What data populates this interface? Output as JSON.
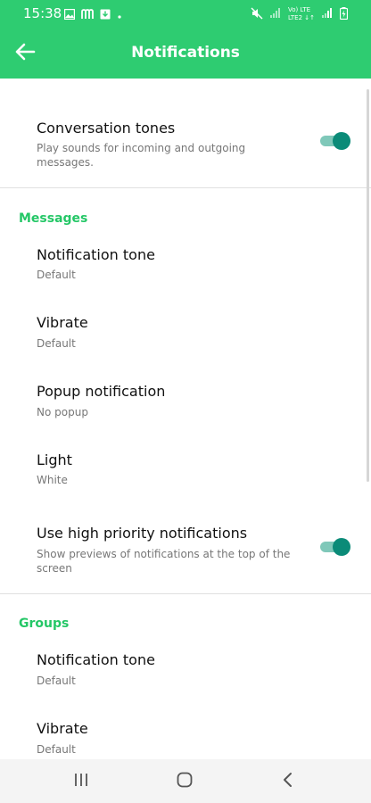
{
  "status_bar": {
    "time": "15:38",
    "left_icons": [
      "gallery-icon",
      "m-icon",
      "download-icon",
      "dot-icon"
    ],
    "right_icons": [
      "mute-icon",
      "signal-icon",
      "volte-lte-icon",
      "signal-icon",
      "battery-charging-icon"
    ],
    "network_label_top": "Vo) LTE",
    "network_label_bottom": "LTE2 ↓↑"
  },
  "app_bar": {
    "title": "Notifications",
    "back_icon": "arrow-left-icon"
  },
  "conversation_tones": {
    "title": "Conversation tones",
    "subtitle_line1": "Play sounds for incoming and outgoing",
    "subtitle_line2": "messages.",
    "enabled": true
  },
  "messages": {
    "header": "Messages",
    "items": [
      {
        "title": "Notification tone",
        "value": "Default"
      },
      {
        "title": "Vibrate",
        "value": "Default"
      },
      {
        "title": "Popup notification",
        "value": "No popup"
      },
      {
        "title": "Light",
        "value": "White"
      }
    ],
    "high_priority": {
      "title": "Use high priority notifications",
      "subtitle_line1": "Show previews of notifications at the top of the",
      "subtitle_line2": "screen",
      "enabled": true
    }
  },
  "groups": {
    "header": "Groups",
    "items": [
      {
        "title": "Notification tone",
        "value": "Default"
      },
      {
        "title": "Vibrate",
        "value": "Default"
      }
    ]
  },
  "nav_bar": {
    "recents_icon": "recents-icon",
    "home_icon": "home-icon",
    "back_icon": "chevron-left-icon"
  },
  "colors": {
    "brand": "#2ecc71",
    "section_header": "#25c767",
    "toggle_on": "#0b8b78"
  }
}
